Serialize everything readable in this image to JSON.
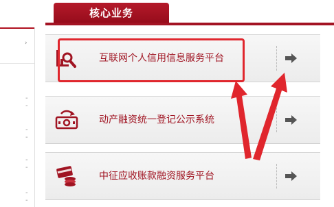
{
  "header": {
    "tab_title": "核心业务"
  },
  "services": [
    {
      "label": "互联网个人信用信息服务平台",
      "icon": "credit-search-icon",
      "arrow": "arrow-right-icon"
    },
    {
      "label": "动产融资统一登记公示系统",
      "icon": "registration-money-icon",
      "arrow": "arrow-right-icon"
    },
    {
      "label": "中征应收账款融资服务平台",
      "icon": "card-coins-icon",
      "arrow": "arrow-right-icon"
    }
  ],
  "colors": {
    "brand_red": "#a31323",
    "label_red": "#a01422",
    "annotation_red": "#e0262d",
    "row_bg": "#f0f0f0"
  }
}
